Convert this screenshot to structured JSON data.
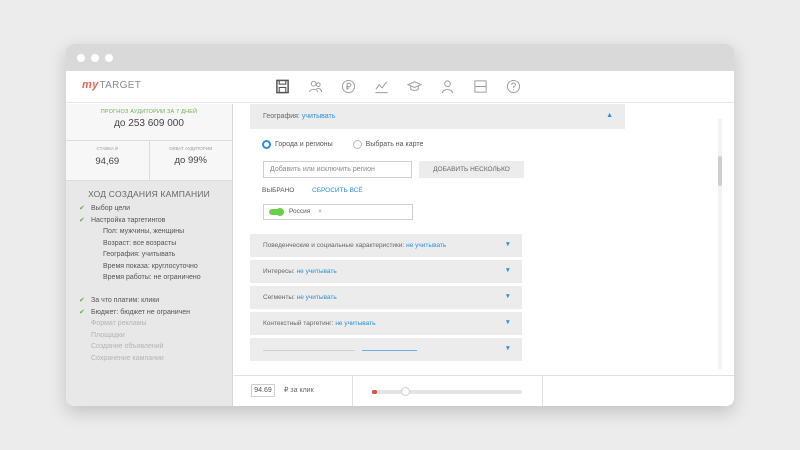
{
  "app": {
    "logo_my": "my",
    "logo_target": "TARGET"
  },
  "nav": {
    "icons": [
      "save-icon",
      "audience-icon",
      "ruble-icon",
      "stats-icon",
      "education-icon",
      "profile-icon",
      "window-icon",
      "help-icon"
    ],
    "active": "save-icon"
  },
  "sidebar": {
    "audience_label": "ПРОГНОЗ АУДИТОРИИ ЗА 7 ДНЕЙ",
    "audience_value": "до 253 609 000",
    "rate_label": "СТАВКА ₽",
    "rate_value": "94,69",
    "coverage_label": "ОХВАТ АУДИТОРИИ",
    "coverage_value": "до 99%",
    "progress_title": "ХОД СОЗДАНИЯ КАМПАНИИ",
    "steps": [
      {
        "label": "Выбор цели",
        "checked": true,
        "sub": false,
        "done": true
      },
      {
        "label": "Настройка таргетингов",
        "checked": true,
        "sub": false,
        "done": true
      },
      {
        "label": "Пол: мужчины, женщины",
        "checked": false,
        "sub": true,
        "done": true
      },
      {
        "label": "Возраст: все возрасты",
        "checked": false,
        "sub": true,
        "done": true
      },
      {
        "label": "География: учитывать",
        "checked": false,
        "sub": true,
        "done": true
      },
      {
        "label": "Время показа: круглосуточно",
        "checked": false,
        "sub": true,
        "done": true
      },
      {
        "label": "Время работы: не ограничено",
        "checked": false,
        "sub": true,
        "done": true
      },
      {
        "label": "",
        "checked": false,
        "sub": false,
        "done": true
      },
      {
        "label": "За что платим: клики",
        "checked": true,
        "sub": false,
        "done": true
      },
      {
        "label": "Бюджет: бюджет не ограничен",
        "checked": true,
        "sub": false,
        "done": true
      },
      {
        "label": "Формат рекламы",
        "checked": false,
        "sub": false,
        "done": false
      },
      {
        "label": "Площадки",
        "checked": false,
        "sub": false,
        "done": false
      },
      {
        "label": "Создание объявлений",
        "checked": false,
        "sub": false,
        "done": false
      },
      {
        "label": "Сохранение кампании",
        "checked": false,
        "sub": false,
        "done": false
      }
    ]
  },
  "geo": {
    "title": "География:",
    "status": "учитывать",
    "radio_cities": "Города и регионы",
    "radio_map": "Выбрать на карте",
    "input_placeholder": "Добавить или исключить регион",
    "add_many": "ДОБАВИТЬ НЕСКОЛЬКО",
    "selected_label": "ВЫБРАНО",
    "reset_label": "СБРОСИТЬ ВСЁ",
    "chip_label": "Россия",
    "chip_remove": "×"
  },
  "sections": [
    {
      "title": "Поведенческие и социальные характеристики:",
      "status": "не учитывать"
    },
    {
      "title": "Интересы:",
      "status": "не учитывать"
    },
    {
      "title": "Сегменты:",
      "status": "не учитывать"
    },
    {
      "title": "Контекстный таргетинг:",
      "status": "не учитывать"
    }
  ],
  "footer": {
    "cpc_value": "94.69",
    "cpc_label": "₽ за клик",
    "slider_fraction": 0.22
  },
  "colors": {
    "accent_blue": "#2d8fd8",
    "check_green": "#6bb04b",
    "slider_red": "#e04b44"
  }
}
